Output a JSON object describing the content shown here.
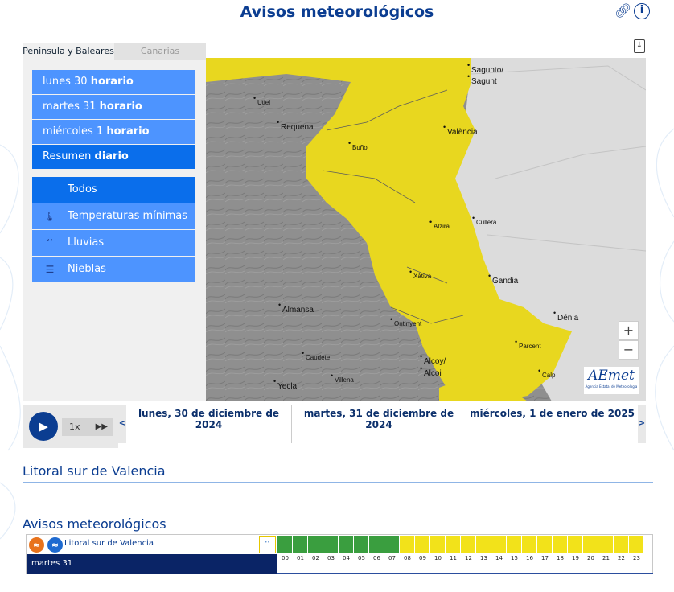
{
  "header": {
    "title": "Avisos meteorológicos"
  },
  "left_panel": {
    "tabs": [
      {
        "label": "Peninsula y Baleares",
        "active": true
      },
      {
        "label": "Canarias",
        "active": false
      }
    ],
    "days": [
      {
        "day": "lunes 30",
        "mode": "horario",
        "selected": false
      },
      {
        "day": "martes 31",
        "mode": "horario",
        "selected": false
      },
      {
        "day": "miércoles 1",
        "mode": "horario",
        "selected": false
      },
      {
        "day": "Resumen",
        "mode": "diario",
        "selected": true
      }
    ],
    "types": [
      {
        "label": "Todos",
        "icon": "",
        "selected": true
      },
      {
        "label": "Temperaturas mínimas",
        "icon": "thermometer-icon",
        "selected": false
      },
      {
        "label": "Lluvias",
        "icon": "rain-icon",
        "selected": false
      },
      {
        "label": "Nieblas",
        "icon": "fog-icon",
        "selected": false
      }
    ]
  },
  "map": {
    "colors": {
      "warning": "#e8d71f",
      "terrain": "#8f8f8f",
      "sea": "#dcdcdc"
    },
    "cities": [
      "Sagunto/",
      "Sagunt",
      "Utiel",
      "Requena",
      "València",
      "Buñol",
      "Alzira",
      "Cullera",
      "Xàtiva",
      "Gandia",
      "Almansa",
      "Ontinyent",
      "Dénia",
      "Parcent",
      "Caudete",
      "Alcoy/",
      "Alcoi",
      "Villena",
      "Calp",
      "Yecla"
    ],
    "zoom_in": "+",
    "zoom_out": "−",
    "logo_text": "AEmet",
    "logo_subtext": "Agencia Estatal de Meteorología"
  },
  "player": {
    "speed": "1x",
    "prev": "<",
    "next": ">"
  },
  "timeline": {
    "days": [
      "lunes, 30 de diciembre de 2024",
      "martes, 31 de diciembre de 2024",
      "miércoles, 1 de enero de 2025"
    ]
  },
  "zone_title": "Litoral sur de Valencia",
  "warnings": {
    "title": "Avisos meteorológicos",
    "zone": "Litoral sur de Valencia",
    "day": "martes 31",
    "hours": [
      "00",
      "01",
      "02",
      "03",
      "04",
      "05",
      "06",
      "07",
      "08",
      "09",
      "10",
      "11",
      "12",
      "13",
      "14",
      "15",
      "16",
      "17",
      "18",
      "19",
      "20",
      "21",
      "22",
      "23"
    ],
    "levels": [
      "green",
      "green",
      "green",
      "green",
      "green",
      "green",
      "green",
      "green",
      "yellow",
      "yellow",
      "yellow",
      "yellow",
      "yellow",
      "yellow",
      "yellow",
      "yellow",
      "yellow",
      "yellow",
      "yellow",
      "yellow",
      "yellow",
      "yellow",
      "yellow",
      "yellow"
    ],
    "colors": {
      "green": "#3a9e3f",
      "yellow": "#f2e21a"
    }
  }
}
